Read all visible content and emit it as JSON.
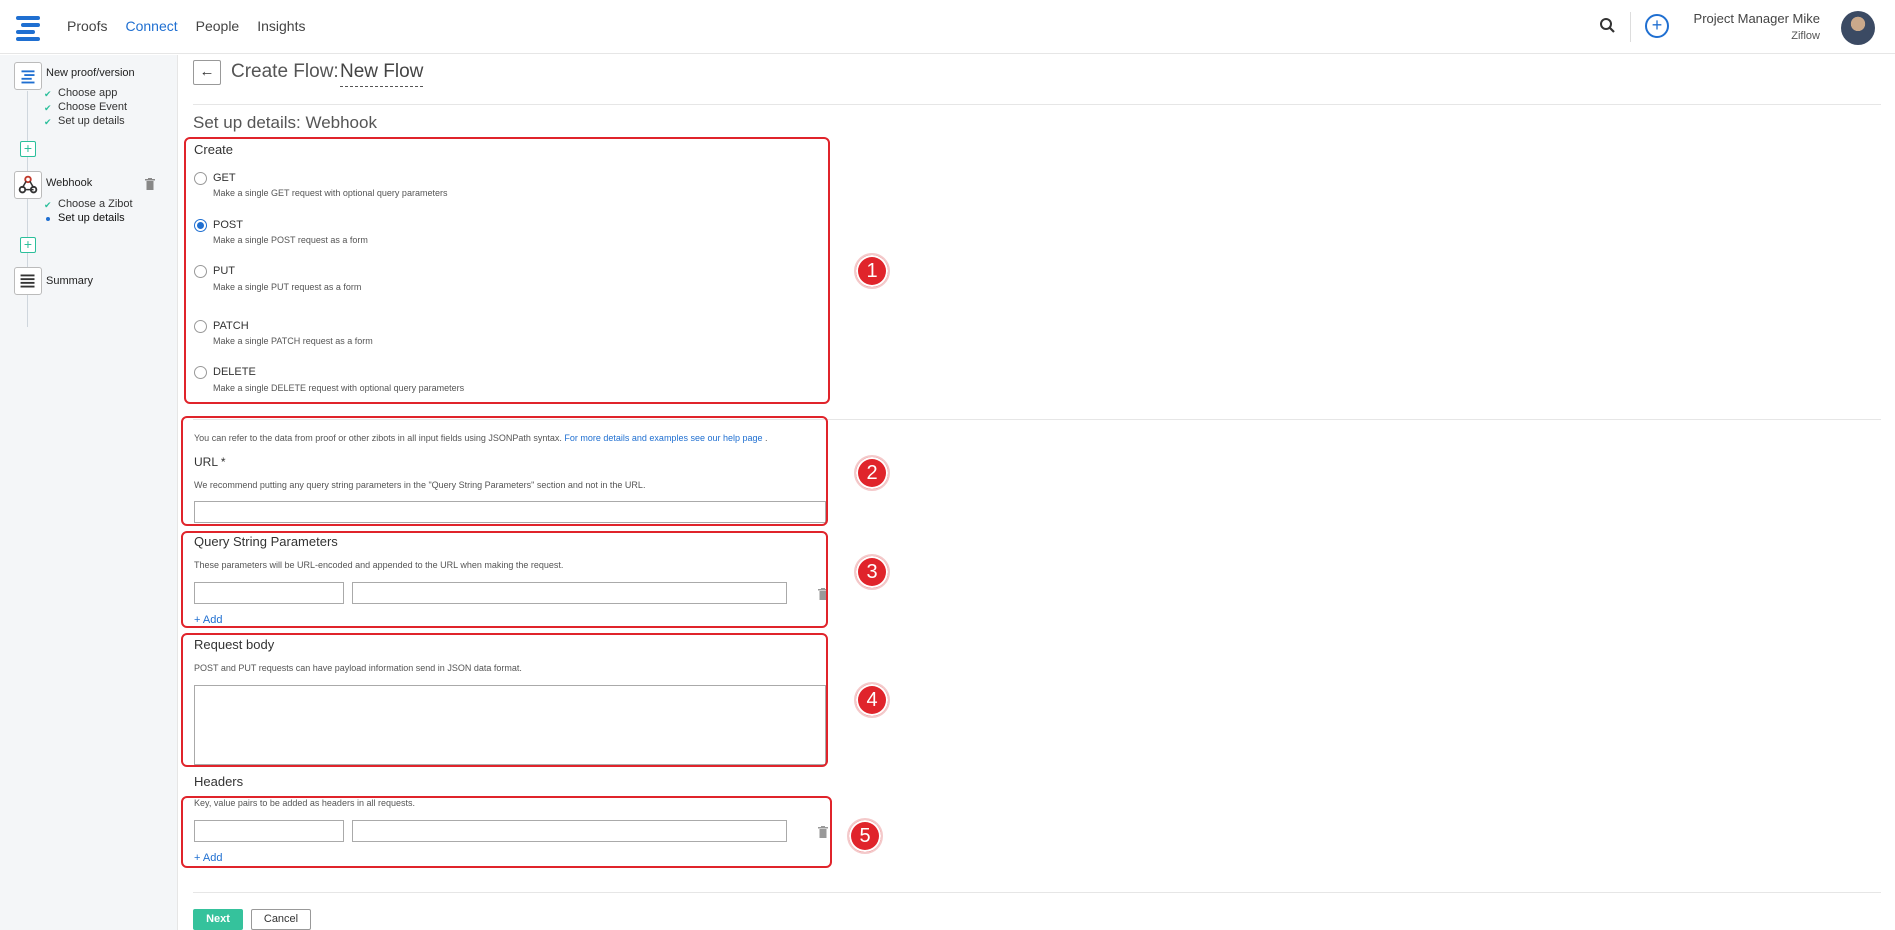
{
  "nav": {
    "items": [
      "Proofs",
      "Connect",
      "People",
      "Insights"
    ],
    "active": "Connect"
  },
  "user": {
    "name": "Project Manager Mike",
    "org": "Ziflow"
  },
  "sidebar": {
    "steps": [
      {
        "title": "New proof/version",
        "substeps": [
          "Choose app",
          "Choose Event",
          "Set up details"
        ]
      },
      {
        "title": "Webhook",
        "substeps": [
          "Choose a Zibot",
          "Set up details"
        ]
      },
      {
        "title": "Summary",
        "substeps": []
      }
    ]
  },
  "header": {
    "title": "Create Flow:",
    "flow_name": "New Flow"
  },
  "section_title": "Set up details: Webhook",
  "create": {
    "label": "Create",
    "options": [
      {
        "label": "GET",
        "desc": "Make a single GET request with optional query parameters"
      },
      {
        "label": "POST",
        "desc": "Make a single POST request as a form"
      },
      {
        "label": "PUT",
        "desc": "Make a single PUT request as a form"
      },
      {
        "label": "PATCH",
        "desc": "Make a single PATCH request as a form"
      },
      {
        "label": "DELETE",
        "desc": "Make a single DELETE request with optional query parameters"
      }
    ],
    "selected": "POST"
  },
  "url": {
    "info_text": "You can refer to the data from proof or other zibots in all input fields using JSONPath syntax.",
    "info_link": "For more details and examples see our help page",
    "info_end": ".",
    "label": "URL *",
    "desc": "We recommend putting any query string parameters in the \"Query String Parameters\" section and not in the URL.",
    "value": ""
  },
  "query": {
    "label": "Query String Parameters",
    "desc": "These parameters will be URL-encoded and appended to the URL when making the request.",
    "add": "+ Add"
  },
  "body": {
    "label": "Request body",
    "desc": "POST and PUT requests can have payload information send in JSON data format."
  },
  "headers": {
    "label": "Headers",
    "desc": "Key, value pairs to be added as headers in all requests.",
    "add": "+ Add"
  },
  "annotations": [
    "1",
    "2",
    "3",
    "4",
    "5"
  ],
  "buttons": {
    "next": "Next",
    "cancel": "Cancel"
  },
  "colors": {
    "accent": "#1f6fd1",
    "success": "#35c29c",
    "annotation": "#e0242b"
  }
}
